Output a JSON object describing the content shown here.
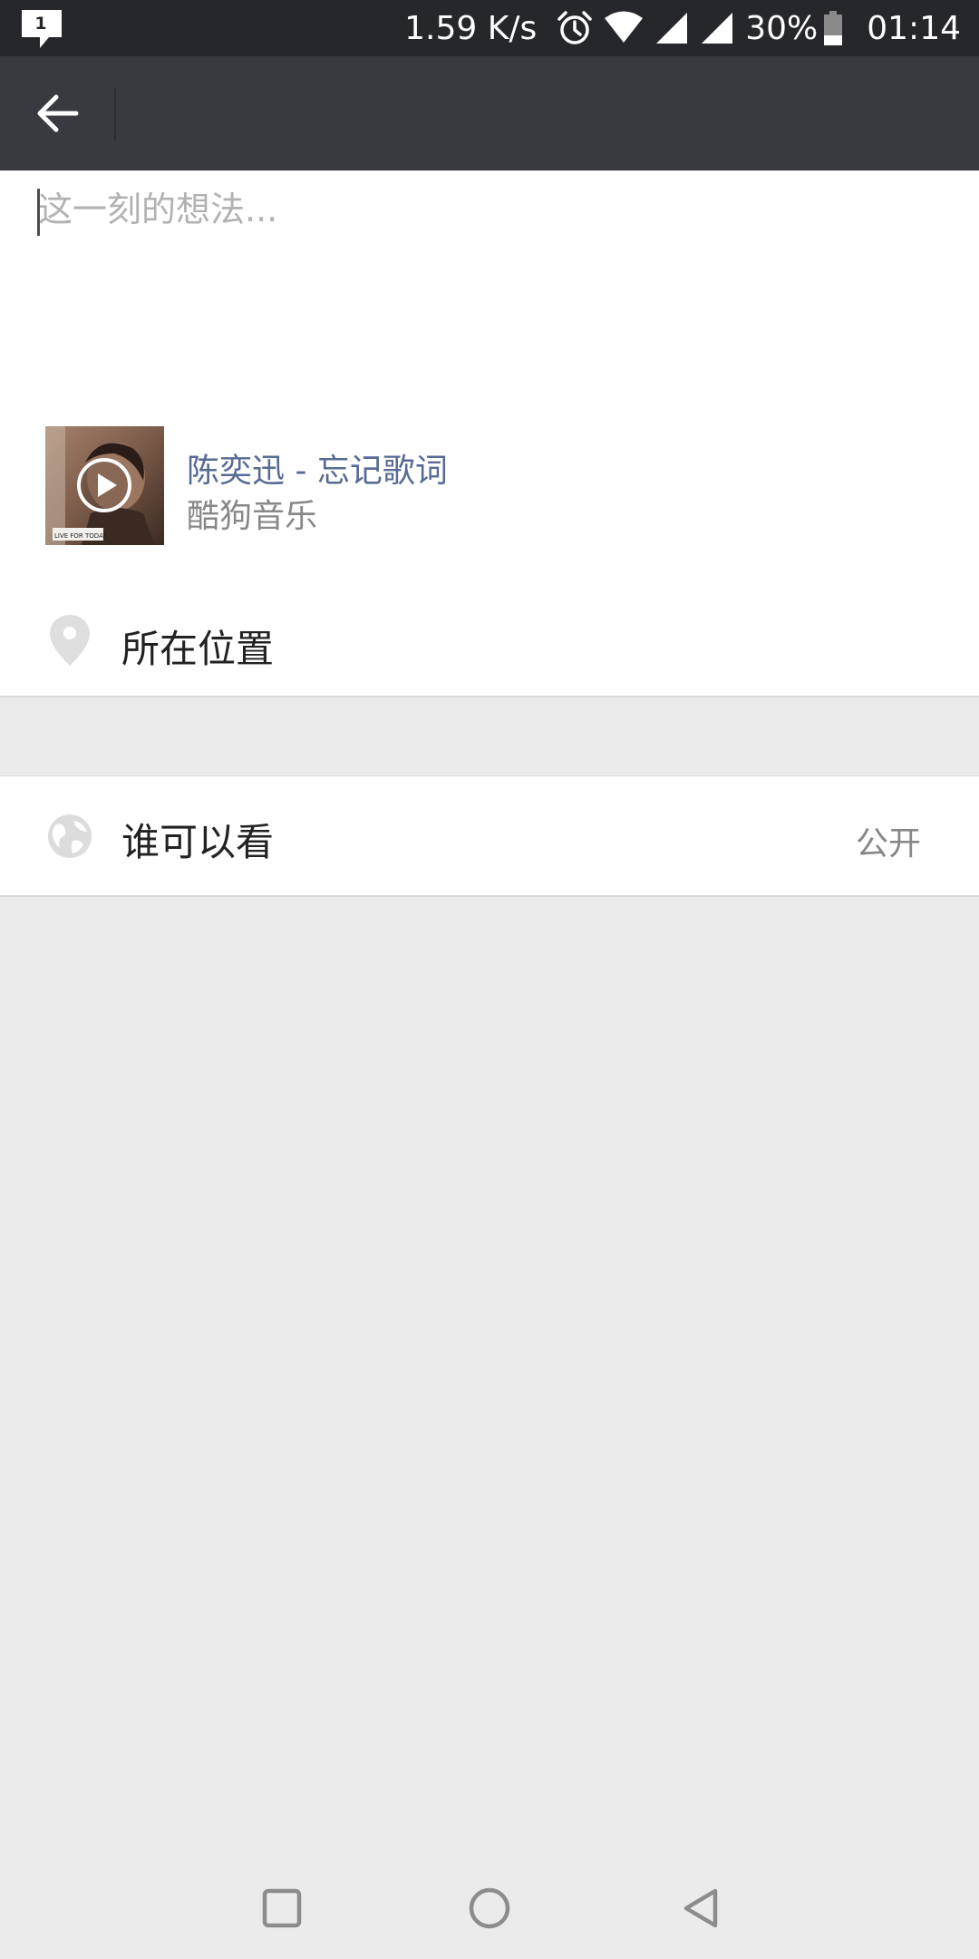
{
  "status_bar": {
    "notification_count": "1",
    "network_speed": "1.59 K/s",
    "battery_percent": "30%",
    "time": "01:14"
  },
  "toolbar": {
    "back_icon": "arrow-left-icon"
  },
  "compose": {
    "placeholder": "这一刻的想法..."
  },
  "music": {
    "title": "陈奕迅 - 忘记歌词",
    "source": "酷狗音乐"
  },
  "location": {
    "label": "所在位置"
  },
  "visibility": {
    "label": "谁可以看",
    "value": "公开"
  },
  "colors": {
    "toolbar_bg": "#393a3f",
    "status_bar_bg": "#26272b",
    "link_blue": "#576b95",
    "page_bg": "#ebebeb"
  }
}
